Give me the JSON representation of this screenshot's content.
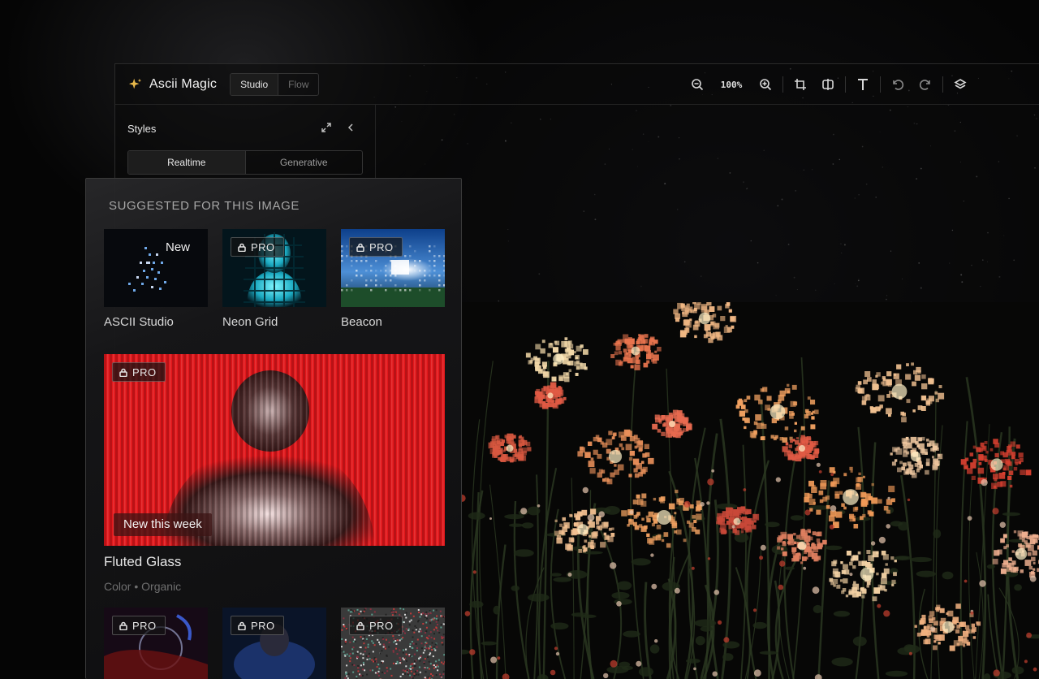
{
  "app": {
    "name": "Ascii Magic",
    "modes": [
      "Studio",
      "Flow"
    ],
    "active_mode": "Studio"
  },
  "toolbar": {
    "zoom_level": "100%",
    "tools": [
      "zoom-out-icon",
      "zoom-in-icon",
      "crop-icon",
      "compare-icon",
      "text-icon",
      "undo-icon",
      "redo-icon",
      "layers-icon"
    ]
  },
  "styles_panel": {
    "title": "Styles",
    "tabs": [
      "Realtime",
      "Generative"
    ],
    "active_tab": "Realtime"
  },
  "suggested": {
    "heading": "SUGGESTED FOR THIS IMAGE",
    "items": [
      {
        "label": "ASCII Studio",
        "badge": "New"
      },
      {
        "label": "Neon Grid",
        "badge": "PRO"
      },
      {
        "label": "Beacon",
        "badge": "PRO"
      }
    ],
    "featured": {
      "badge": "PRO",
      "tag": "New this week",
      "title": "Fluted Glass",
      "meta": "Color • Organic"
    },
    "more_items": [
      {
        "badge": "PRO"
      },
      {
        "badge": "PRO"
      },
      {
        "badge": "PRO"
      }
    ]
  },
  "colors": {
    "accent_star": "#e8b84a",
    "featured_red": "#e0161a",
    "neon_cyan": "#3ad6e6"
  }
}
